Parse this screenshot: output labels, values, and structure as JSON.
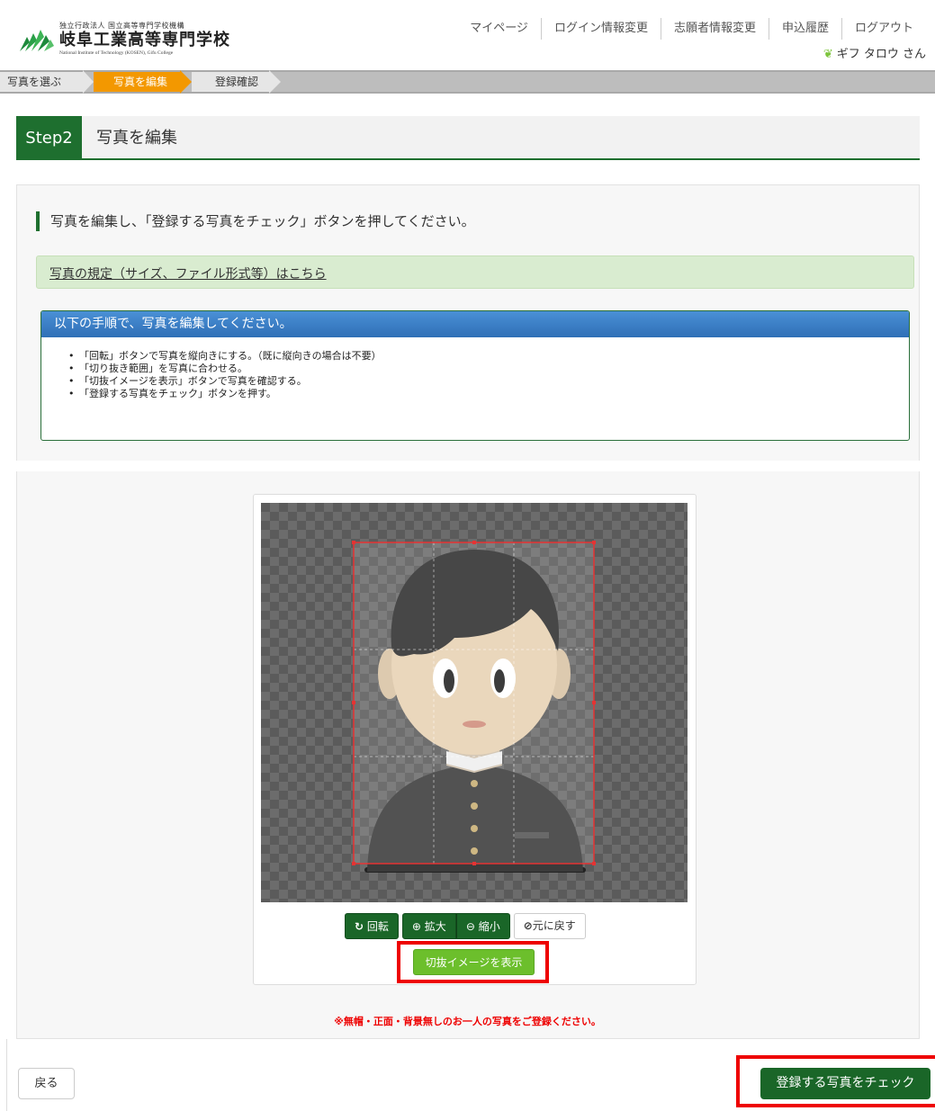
{
  "header": {
    "logo_small": "独立行政法人  国立高等専門学校機構",
    "logo_title": "岐阜工業高等専門学校",
    "logo_en": "National Institute of Technology (KOSEN), Gifu College",
    "nav": [
      "マイページ",
      "ログイン情報変更",
      "志願者情報変更",
      "申込履歴",
      "ログアウト"
    ],
    "user": "ギフ タロウ さん"
  },
  "steps": [
    "写真を選ぶ",
    "写真を編集",
    "登録確認"
  ],
  "page": {
    "step_tag": "Step2",
    "step_title": "写真を編集",
    "instruction": "写真を編集し、「登録する写真をチェック」ボタンを押してください。",
    "rules_link": "写真の規定（サイズ、ファイル形式等）はこちら"
  },
  "howto": {
    "heading": "以下の手順で、写真を編集してください。",
    "items": [
      "「回転」ボタンで写真を縦向きにする。（既に縦向きの場合は不要）",
      "「切り抜き範囲」を写真に合わせる。",
      "「切抜イメージを表示」ボタンで写真を確認する。",
      "「登録する写真をチェック」ボタンを押す。"
    ]
  },
  "editor": {
    "rotate": "回転",
    "zoom_in": "拡大",
    "zoom_out": "縮小",
    "reset": "元に戻す",
    "preview": "切抜イメージを表示"
  },
  "warning": "※無帽・正面・背景無しのお一人の写真をご登録ください。",
  "footer": {
    "back": "戻る",
    "submit": "登録する写真をチェック"
  },
  "colors": {
    "brand_green": "#1a6628",
    "step_active": "#f39800",
    "highlight": "#ee0000",
    "preview_button": "#6cbf2c"
  }
}
